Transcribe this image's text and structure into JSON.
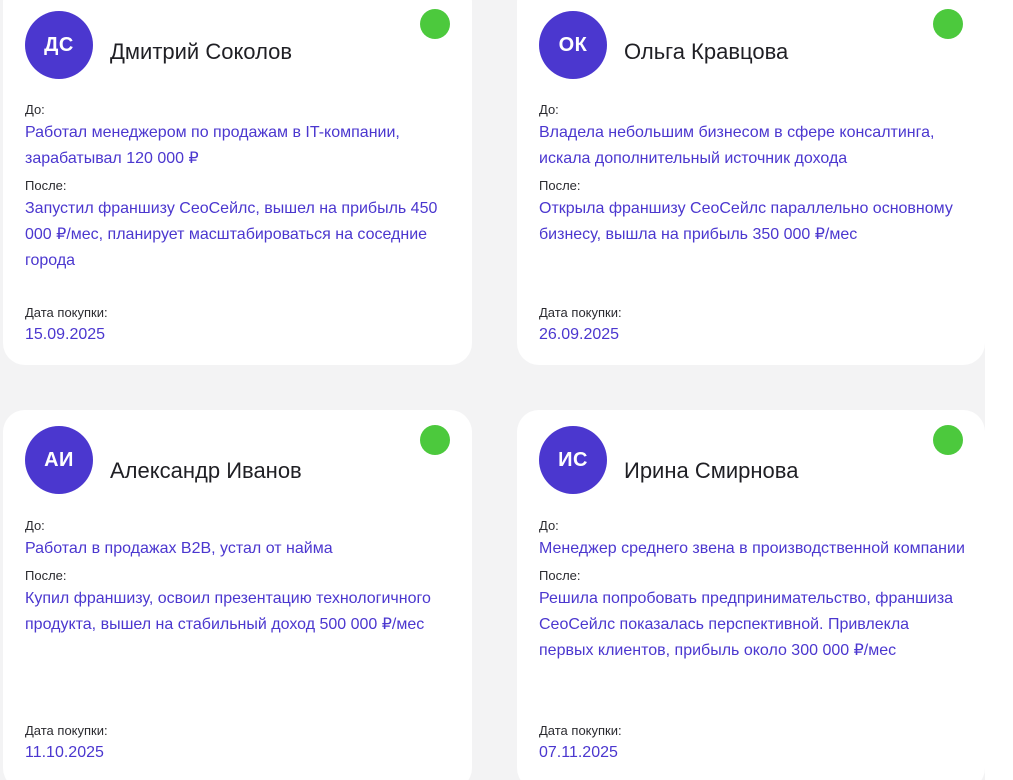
{
  "cards": [
    {
      "initials": "ДС",
      "name": "Дмитрий Соколов",
      "before_label": "До:",
      "before_text": "Работал менеджером по продажам в IT-компании, зарабатывал 120 000 ₽",
      "after_label": "После:",
      "after_text": "Запустил франшизу СеоСейлс, вышел на прибыль 450 000 ₽/мес, планирует масштабироваться на соседние города",
      "date_label": "Дата покупки:",
      "date": "15.09.2025",
      "status": "active"
    },
    {
      "initials": "ОК",
      "name": "Ольга Кравцова",
      "before_label": "До:",
      "before_text": "Владела небольшим бизнесом в сфере консалтинга, искала дополнительный источник дохода",
      "after_label": "После:",
      "after_text": "Открыла франшизу СеоСейлс параллельно основному бизнесу, вышла на прибыль 350 000 ₽/мес",
      "date_label": "Дата покупки:",
      "date": "26.09.2025",
      "status": "active"
    },
    {
      "initials": "АИ",
      "name": "Александр Иванов",
      "before_label": "До:",
      "before_text": "Работал в продажах B2B, устал от найма",
      "after_label": "После:",
      "after_text": "Купил франшизу, освоил презентацию технологичного продукта, вышел на стабильный доход 500 000 ₽/мес",
      "date_label": "Дата покупки:",
      "date": "11.10.2025",
      "status": "active"
    },
    {
      "initials": "ИС",
      "name": "Ирина Смирнова",
      "before_label": "До:",
      "before_text": "Менеджер среднего звена в производственной компании",
      "after_label": "После:",
      "after_text": "Решила попробовать предпринимательство, франшиза СеоСейлс показалась перспективной. Привлекла первых клиентов, прибыль около 300 000 ₽/мес",
      "date_label": "Дата покупки:",
      "date": "07.11.2025",
      "status": "active"
    }
  ],
  "colors": {
    "accent": "#4b37cf",
    "status_active": "#4cc93d",
    "card_bg": "#ffffff",
    "page_bg": "#f3f3f4"
  }
}
